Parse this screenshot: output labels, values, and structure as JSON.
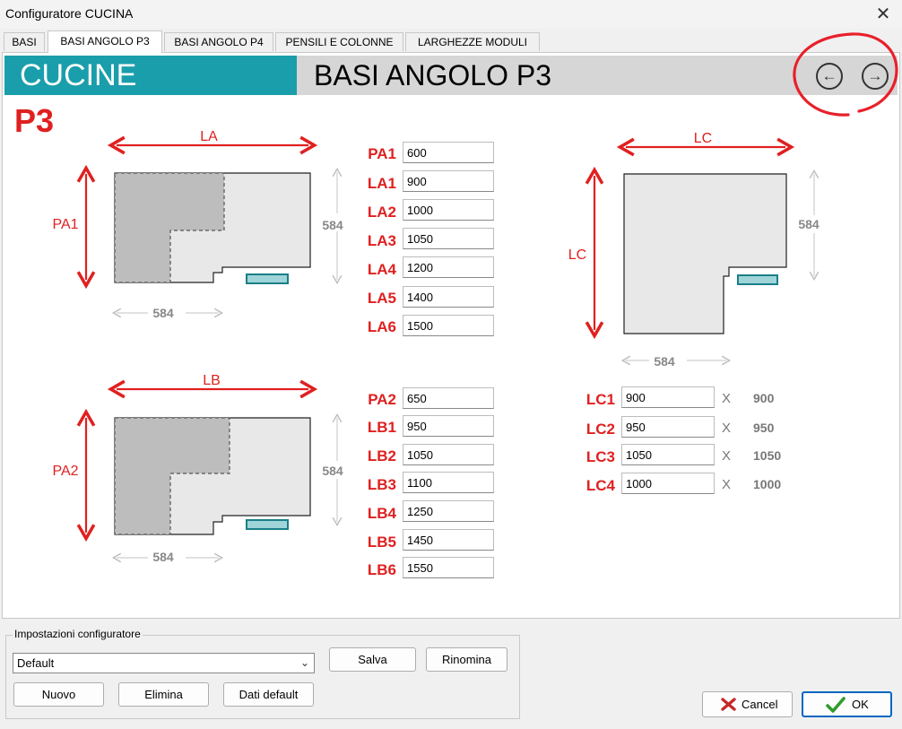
{
  "window": {
    "title": "Configuratore CUCINA",
    "close_glyph": "✕"
  },
  "tabs": [
    {
      "label": "BASI"
    },
    {
      "label": "BASI ANGOLO P3"
    },
    {
      "label": "BASI ANGOLO P4"
    },
    {
      "label": "PENSILI E COLONNE"
    },
    {
      "label": "LARGHEZZE MODULI"
    }
  ],
  "header": {
    "section": "CUCINE",
    "subtitle": "BASI ANGOLO P3",
    "prev_icon": "←",
    "next_icon": "→"
  },
  "config_title": "P3",
  "diagram1": {
    "width_label": "LA",
    "depth_label": "PA1",
    "right_dim": "584",
    "bottom_dim": "584"
  },
  "diagram2": {
    "width_label": "LB",
    "depth_label": "PA2",
    "right_dim": "584",
    "bottom_dim": "584"
  },
  "diagram3": {
    "width_label": "LC",
    "depth_label": "LC",
    "right_dim": "584",
    "bottom_dim": "584"
  },
  "fields_a": [
    {
      "label": "PA1",
      "value": "600"
    },
    {
      "label": "LA1",
      "value": "900"
    },
    {
      "label": "LA2",
      "value": "1000"
    },
    {
      "label": "LA3",
      "value": "1050"
    },
    {
      "label": "LA4",
      "value": "1200"
    },
    {
      "label": "LA5",
      "value": "1400"
    },
    {
      "label": "LA6",
      "value": "1500"
    }
  ],
  "fields_b": [
    {
      "label": "PA2",
      "value": "650"
    },
    {
      "label": "LB1",
      "value": "950"
    },
    {
      "label": "LB2",
      "value": "1050"
    },
    {
      "label": "LB3",
      "value": "1100"
    },
    {
      "label": "LB4",
      "value": "1250"
    },
    {
      "label": "LB5",
      "value": "1450"
    },
    {
      "label": "LB6",
      "value": "1550"
    }
  ],
  "fields_c": [
    {
      "label": "LC1",
      "value": "900",
      "x": "X",
      "result": "900"
    },
    {
      "label": "LC2",
      "value": "950",
      "x": "X",
      "result": "950"
    },
    {
      "label": "LC3",
      "value": "1050",
      "x": "X",
      "result": "1050"
    },
    {
      "label": "LC4",
      "value": "1000",
      "x": "X",
      "result": "1000"
    }
  ],
  "settings": {
    "group_title": "Impostazioni configuratore",
    "selected": "Default",
    "save": "Salva",
    "rename": "Rinomina",
    "new": "Nuovo",
    "delete": "Elimina",
    "defaults": "Dati default"
  },
  "dialog": {
    "cancel": "Cancel",
    "ok": "OK"
  },
  "colors": {
    "teal": "#1a9eab",
    "red": "#e02020",
    "annotation": "#e8202a"
  }
}
